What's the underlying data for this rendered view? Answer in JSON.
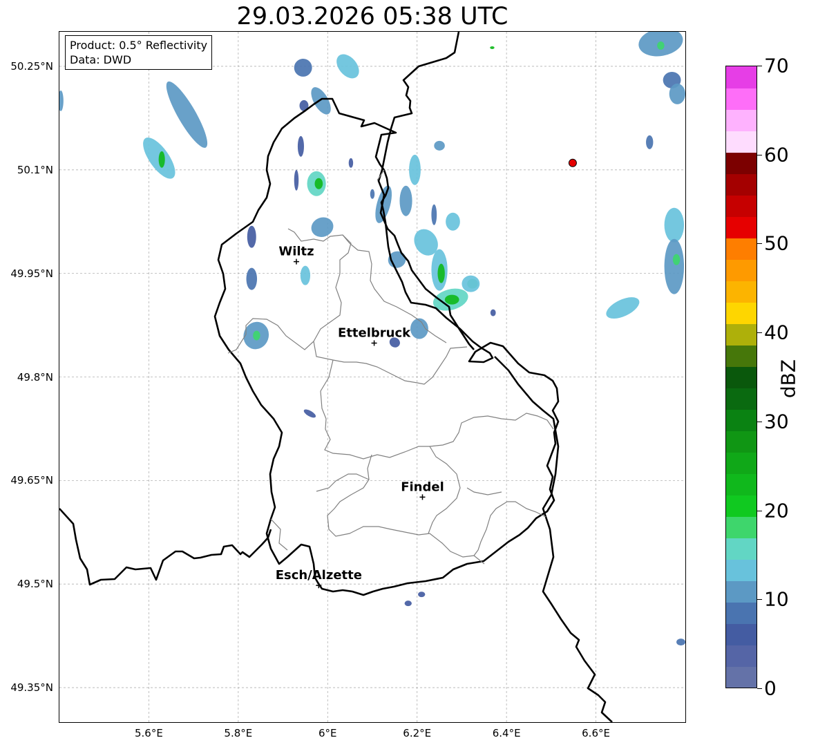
{
  "title": "29.03.2026 05:38 UTC",
  "info_box": {
    "product": "Product: 0.5° Reflectivity",
    "data": "Data: DWD"
  },
  "map": {
    "extent": {
      "lon_min": 5.4,
      "lon_max": 6.8,
      "lat_min": 49.3,
      "lat_max": 50.3
    },
    "lat_ticks": [
      {
        "value": 50.25,
        "label": "50.25°N"
      },
      {
        "value": 50.1,
        "label": "50.1°N"
      },
      {
        "value": 49.95,
        "label": "49.95°N"
      },
      {
        "value": 49.8,
        "label": "49.8°N"
      },
      {
        "value": 49.65,
        "label": "49.65°N"
      },
      {
        "value": 49.5,
        "label": "49.5°N"
      },
      {
        "value": 49.35,
        "label": "49.35°N"
      }
    ],
    "lon_ticks": [
      {
        "value": 5.6,
        "label": "5.6°E"
      },
      {
        "value": 5.8,
        "label": "5.8°E"
      },
      {
        "value": 6.0,
        "label": "6°E"
      },
      {
        "value": 6.2,
        "label": "6.2°E"
      },
      {
        "value": 6.4,
        "label": "6.4°E"
      },
      {
        "value": 6.6,
        "label": "6.6°E"
      }
    ],
    "cities": [
      {
        "name": "Wiltz",
        "lon": 5.93,
        "lat": 49.967
      },
      {
        "name": "Ettelbruck",
        "lon": 6.104,
        "lat": 49.849
      },
      {
        "name": "Findel",
        "lon": 6.212,
        "lat": 49.626
      },
      {
        "name": "Esch/Alzette",
        "lon": 5.98,
        "lat": 49.498
      }
    ],
    "radar_site": {
      "lon": 6.548,
      "lat": 50.11,
      "color": "#e50000"
    },
    "radar_echoes": [
      {
        "lon": 5.623,
        "lat": 50.117,
        "rlon": 0.022,
        "rlat": 0.035,
        "rot": -35,
        "dbz": 13
      },
      {
        "lon": 5.685,
        "lat": 50.18,
        "rlon": 0.02,
        "rlat": 0.055,
        "rot": -30,
        "dbz": 12
      },
      {
        "lon": 5.629,
        "lat": 50.115,
        "rlon": 0.007,
        "rlat": 0.012,
        "rot": 0,
        "dbz": 22
      },
      {
        "lon": 5.403,
        "lat": 50.2,
        "rlon": 0.006,
        "rlat": 0.015,
        "rot": 0,
        "dbz": 10
      },
      {
        "lon": 5.945,
        "lat": 50.248,
        "rlon": 0.02,
        "rlat": 0.013,
        "rot": 20,
        "dbz": 8
      },
      {
        "lon": 6.045,
        "lat": 50.25,
        "rlon": 0.02,
        "rlat": 0.02,
        "rot": -40,
        "dbz": 13
      },
      {
        "lon": 5.985,
        "lat": 50.2,
        "rlon": 0.016,
        "rlat": 0.022,
        "rot": -30,
        "dbz": 11
      },
      {
        "lon": 5.947,
        "lat": 50.193,
        "rlon": 0.01,
        "rlat": 0.008,
        "rot": 0,
        "dbz": 5
      },
      {
        "lon": 5.94,
        "lat": 50.134,
        "rlon": 0.007,
        "rlat": 0.015,
        "rot": 0,
        "dbz": 7
      },
      {
        "lon": 5.975,
        "lat": 50.08,
        "rlon": 0.021,
        "rlat": 0.018,
        "rot": 0,
        "dbz": 15
      },
      {
        "lon": 5.98,
        "lat": 50.08,
        "rlon": 0.009,
        "rlat": 0.008,
        "rot": 0,
        "dbz": 22
      },
      {
        "lon": 5.93,
        "lat": 50.085,
        "rlon": 0.005,
        "rlat": 0.015,
        "rot": 0,
        "dbz": 6
      },
      {
        "lon": 6.052,
        "lat": 50.11,
        "rlon": 0.005,
        "rlat": 0.007,
        "rot": 0,
        "dbz": 7
      },
      {
        "lon": 5.988,
        "lat": 50.017,
        "rlon": 0.025,
        "rlat": 0.014,
        "rot": -20,
        "dbz": 12
      },
      {
        "lon": 5.83,
        "lat": 50.003,
        "rlon": 0.01,
        "rlat": 0.016,
        "rot": 0,
        "dbz": 7
      },
      {
        "lon": 5.95,
        "lat": 49.947,
        "rlon": 0.011,
        "rlat": 0.014,
        "rot": 0,
        "dbz": 13
      },
      {
        "lon": 5.83,
        "lat": 49.942,
        "rlon": 0.012,
        "rlat": 0.016,
        "rot": 0,
        "dbz": 8
      },
      {
        "lon": 5.84,
        "lat": 49.86,
        "rlon": 0.028,
        "rlat": 0.02,
        "rot": 20,
        "dbz": 11
      },
      {
        "lon": 5.841,
        "lat": 49.86,
        "rlon": 0.008,
        "rlat": 0.007,
        "rot": 0,
        "dbz": 17
      },
      {
        "lon": 5.96,
        "lat": 49.747,
        "rlon": 0.015,
        "rlat": 0.004,
        "rot": 30,
        "dbz": 6
      },
      {
        "lon": 6.125,
        "lat": 50.05,
        "rlon": 0.015,
        "rlat": 0.028,
        "rot": 15,
        "dbz": 12
      },
      {
        "lon": 6.195,
        "lat": 50.1,
        "rlon": 0.013,
        "rlat": 0.022,
        "rot": 0,
        "dbz": 13
      },
      {
        "lon": 6.175,
        "lat": 50.055,
        "rlon": 0.014,
        "rlat": 0.022,
        "rot": 0,
        "dbz": 10
      },
      {
        "lon": 6.25,
        "lat": 50.135,
        "rlon": 0.012,
        "rlat": 0.007,
        "rot": 0,
        "dbz": 12
      },
      {
        "lon": 6.28,
        "lat": 50.025,
        "rlon": 0.016,
        "rlat": 0.013,
        "rot": 0,
        "dbz": 13
      },
      {
        "lon": 6.22,
        "lat": 49.995,
        "rlon": 0.025,
        "rlat": 0.02,
        "rot": -30,
        "dbz": 14
      },
      {
        "lon": 6.238,
        "lat": 50.035,
        "rlon": 0.006,
        "rlat": 0.015,
        "rot": 0,
        "dbz": 9
      },
      {
        "lon": 6.155,
        "lat": 49.97,
        "rlon": 0.02,
        "rlat": 0.012,
        "rot": -20,
        "dbz": 11
      },
      {
        "lon": 6.25,
        "lat": 49.955,
        "rlon": 0.018,
        "rlat": 0.03,
        "rot": 0,
        "dbz": 14
      },
      {
        "lon": 6.254,
        "lat": 49.95,
        "rlon": 0.008,
        "rlat": 0.014,
        "rot": 0,
        "dbz": 22
      },
      {
        "lon": 6.275,
        "lat": 49.912,
        "rlon": 0.04,
        "rlat": 0.015,
        "rot": -15,
        "dbz": 15
      },
      {
        "lon": 6.278,
        "lat": 49.912,
        "rlon": 0.016,
        "rlat": 0.007,
        "rot": 0,
        "dbz": 22
      },
      {
        "lon": 6.324,
        "lat": 49.935,
        "rlon": 0.012,
        "rlat": 0.007,
        "rot": 0,
        "dbz": 19
      },
      {
        "lon": 6.32,
        "lat": 49.935,
        "rlon": 0.02,
        "rlat": 0.012,
        "rot": 0,
        "dbz": 13
      },
      {
        "lon": 6.205,
        "lat": 49.87,
        "rlon": 0.02,
        "rlat": 0.015,
        "rot": 0,
        "dbz": 11
      },
      {
        "lon": 6.15,
        "lat": 49.85,
        "rlon": 0.012,
        "rlat": 0.007,
        "rot": 30,
        "dbz": 7
      },
      {
        "lon": 6.37,
        "lat": 49.893,
        "rlon": 0.006,
        "rlat": 0.005,
        "rot": 0,
        "dbz": 6
      },
      {
        "lon": 6.368,
        "lat": 50.277,
        "rlon": 0.005,
        "rlat": 0.002,
        "rot": 0,
        "dbz": 22
      },
      {
        "lon": 6.1,
        "lat": 50.065,
        "rlon": 0.005,
        "rlat": 0.007,
        "rot": 0,
        "dbz": 8
      },
      {
        "lon": 6.21,
        "lat": 49.485,
        "rlon": 0.008,
        "rlat": 0.004,
        "rot": 0,
        "dbz": 6
      },
      {
        "lon": 6.18,
        "lat": 49.472,
        "rlon": 0.008,
        "rlat": 0.004,
        "rot": 0,
        "dbz": 6
      },
      {
        "lon": 6.745,
        "lat": 50.285,
        "rlon": 0.05,
        "rlat": 0.02,
        "rot": -10,
        "dbz": 10
      },
      {
        "lon": 6.745,
        "lat": 50.28,
        "rlon": 0.008,
        "rlat": 0.006,
        "rot": 0,
        "dbz": 17
      },
      {
        "lon": 6.77,
        "lat": 50.23,
        "rlon": 0.02,
        "rlat": 0.012,
        "rot": 0,
        "dbz": 8
      },
      {
        "lon": 6.782,
        "lat": 50.21,
        "rlon": 0.018,
        "rlat": 0.015,
        "rot": 0,
        "dbz": 12
      },
      {
        "lon": 6.72,
        "lat": 50.14,
        "rlon": 0.008,
        "rlat": 0.01,
        "rot": 0,
        "dbz": 8
      },
      {
        "lon": 6.775,
        "lat": 50.02,
        "rlon": 0.022,
        "rlat": 0.025,
        "rot": 0,
        "dbz": 13
      },
      {
        "lon": 6.775,
        "lat": 49.96,
        "rlon": 0.022,
        "rlat": 0.04,
        "rot": 0,
        "dbz": 12
      },
      {
        "lon": 6.78,
        "lat": 49.97,
        "rlon": 0.008,
        "rlat": 0.008,
        "rot": 0,
        "dbz": 19
      },
      {
        "lon": 6.66,
        "lat": 49.9,
        "rlon": 0.04,
        "rlat": 0.012,
        "rot": -25,
        "dbz": 13
      },
      {
        "lon": 6.79,
        "lat": 49.416,
        "rlon": 0.01,
        "rlat": 0.005,
        "rot": 0,
        "dbz": 8
      }
    ]
  },
  "colorbar": {
    "unit": "dBZ",
    "min": 0,
    "max": 70,
    "tick_labels": [
      "0",
      "10",
      "20",
      "30",
      "40",
      "50",
      "60",
      "70"
    ],
    "colors": [
      "#6472a8",
      "#5565a6",
      "#445ca2",
      "#4a74b0",
      "#5c99c4",
      "#68c2dc",
      "#62d6c4",
      "#3ed66c",
      "#10c920",
      "#10b81c",
      "#10a818",
      "#109614",
      "#0a8212",
      "#0a6a10",
      "#0a580c",
      "#46770a",
      "#aeb00a",
      "#fed600",
      "#fcb400",
      "#fe9a00",
      "#fe7e00",
      "#e60000",
      "#c60000",
      "#a40000",
      "#7c0000",
      "#fedcfe",
      "#feb2fe",
      "#fe6ef8",
      "#e63ee6"
    ]
  }
}
